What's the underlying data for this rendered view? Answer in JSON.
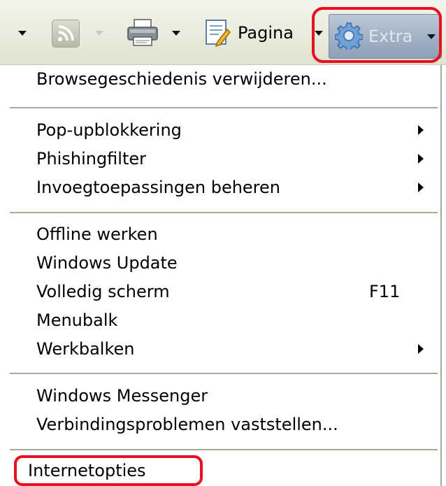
{
  "toolbar": {
    "page_label": "Pagina",
    "tools_label": "Extra",
    "icons": [
      "feeds-icon",
      "printer-icon",
      "page-icon",
      "gear-icon"
    ]
  },
  "menu": {
    "items": [
      {
        "label": "Browsegeschiedenis verwijderen..."
      },
      {
        "label": "Pop-upblokkering",
        "submenu": true
      },
      {
        "label": "Phishingfilter",
        "submenu": true
      },
      {
        "label": "Invoegtoepassingen beheren",
        "submenu": true
      },
      {
        "label": "Offline werken"
      },
      {
        "label": "Windows Update"
      },
      {
        "label": "Volledig scherm",
        "shortcut": "F11"
      },
      {
        "label": "Menubalk"
      },
      {
        "label": "Werkbalken",
        "submenu": true
      },
      {
        "label": "Windows Messenger"
      },
      {
        "label": "Verbindingsproblemen vaststellen..."
      },
      {
        "label": "Internetopties"
      }
    ]
  },
  "colors": {
    "highlight": "#e8101f",
    "toolbar_bg": "#e9ebdd",
    "tools_button_bg": "#a3b2c6",
    "separator": "#aca899"
  }
}
